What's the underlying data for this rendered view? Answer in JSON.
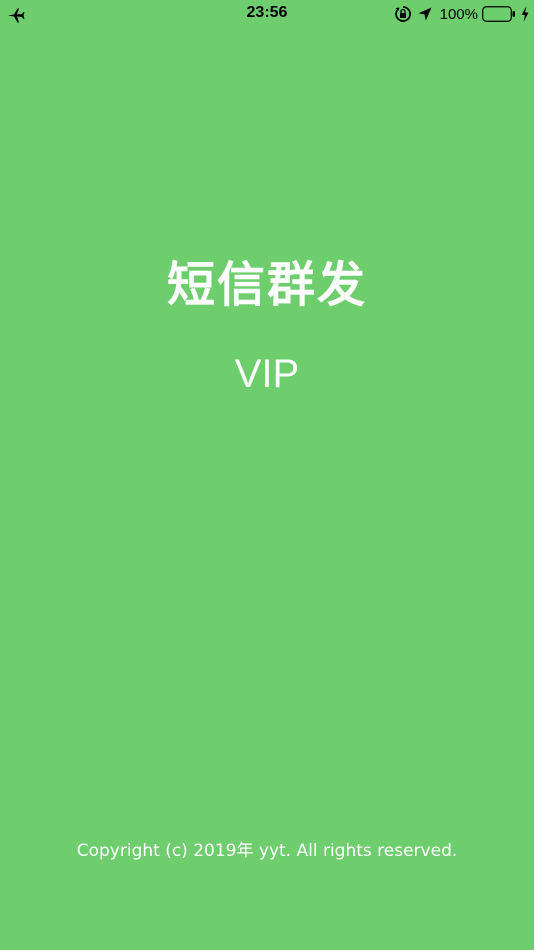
{
  "status_bar": {
    "time": "23:56",
    "battery_percent": "100%",
    "icons": [
      "airplane-icon",
      "orientation-lock-icon",
      "location-arrow-icon",
      "battery-icon",
      "charging-bolt-icon"
    ]
  },
  "splash": {
    "title": "短信群发",
    "subtitle": "VIP",
    "copyright": "Copyright (c) 2019年 yyt. All rights reserved."
  },
  "colors": {
    "background": "#6ece6e",
    "text": "#ffffff",
    "status_text": "#000000"
  }
}
